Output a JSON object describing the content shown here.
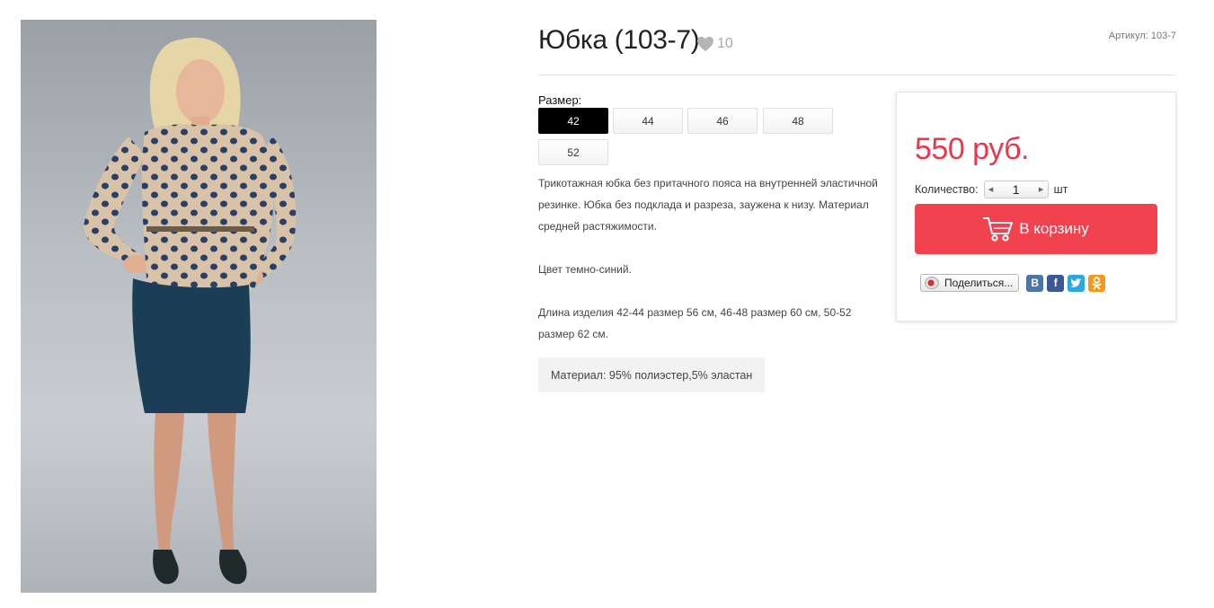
{
  "product": {
    "title": "Юбка (103-7)",
    "likes": "10",
    "sku": "Артикул: 103-7",
    "image_alt": "model wearing navy skirt and polka dot blouse"
  },
  "sizes": {
    "label": "Размер:",
    "options": [
      "42",
      "44",
      "46",
      "48",
      "52"
    ],
    "selected": "42"
  },
  "description": {
    "p1": "Трикотажная юбка без притачного пояса на внутренней эластичной резинке. Юбка без подклада и разреза, заужена к низу. Материал средней растяжимости.",
    "p2": "Цвет темно-синий.",
    "p3": "Длина изделия 42-44 размер 56 см, 46-48 размер 60 см, 50-52 размер 62 см."
  },
  "material": "Материал: 95% полиэстер,5% эластан",
  "buy": {
    "price": "550 руб.",
    "qty_label": "Количество:",
    "qty_value": "1",
    "qty_unit": "шт",
    "cart_label": "В корзину"
  },
  "share": {
    "label": "Поделиться...",
    "networks": [
      {
        "icon": "vk-icon",
        "glyph": "B",
        "color": "#4a76a8"
      },
      {
        "icon": "facebook-icon",
        "glyph": "f",
        "color": "#3b5998"
      },
      {
        "icon": "twitter-icon",
        "glyph": "t",
        "color": "#2ca7e0"
      },
      {
        "icon": "odnoklassniki-icon",
        "glyph": "ok",
        "color": "#f39a1c"
      }
    ]
  },
  "colors": {
    "accent": "#f0424f",
    "price": "#e8384d",
    "selected_size": "#000000"
  }
}
